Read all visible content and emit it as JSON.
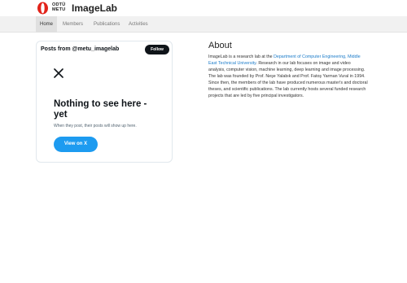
{
  "header": {
    "logo_line1": "ODTÜ",
    "logo_line2": "METU",
    "brand": "ImageLab"
  },
  "nav": {
    "items": [
      {
        "label": "Home",
        "active": true
      },
      {
        "label": "Members"
      },
      {
        "label": "Publications"
      },
      {
        "label": "Activities"
      }
    ]
  },
  "twitter": {
    "title": "Posts from @metu_imagelab",
    "follow_label": "Follow",
    "empty_title": "Nothing to see here - yet",
    "empty_sub": "When they post, their posts will show up here.",
    "view_label": "View on X"
  },
  "about": {
    "title": "About",
    "intro": "ImageLab is a research lab at the ",
    "dept_link": "Department of Computer Engineering, Middle East Technical University",
    "body": ". Research in our lab focuses on image and video analysis, computer vision, machine learning, deep learning and image processing. The lab was founded by Prof. Neşe Yalabık and Prof. Fatoş Yarman Vural in 1994. Since then, the members of the lab have produced numerous master's and doctoral theses, and scientific publications. The lab currently hosts several funded research projects that are led by five principal investigators."
  },
  "colors": {
    "accent": "#1d9bf0",
    "logo_red": "#e2231a",
    "link": "#1a7bc9"
  }
}
